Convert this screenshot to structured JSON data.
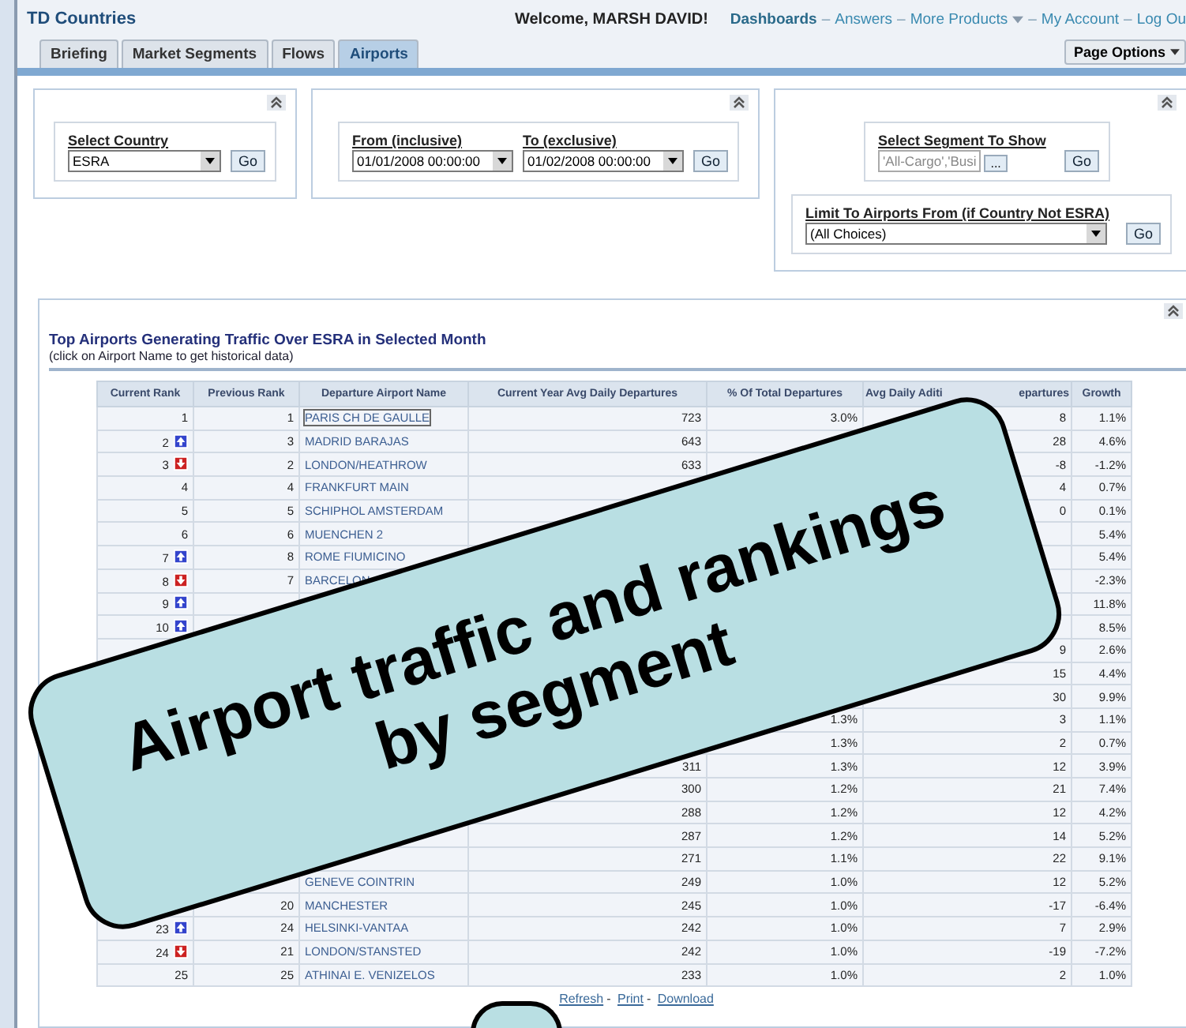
{
  "header": {
    "title": "TD Countries",
    "welcome": "Welcome, MARSH DAVID!",
    "separator": "–",
    "links": [
      {
        "label": "Dashboards",
        "kind": "current"
      },
      {
        "label": "Answers",
        "kind": "link"
      },
      {
        "label": "More Products",
        "kind": "menu"
      },
      {
        "label": "My Account",
        "kind": "link"
      },
      {
        "label": "Log Ou",
        "kind": "link"
      }
    ]
  },
  "tabs": [
    {
      "label": "Briefing",
      "selected": false
    },
    {
      "label": "Market Segments",
      "selected": false
    },
    {
      "label": "Flows",
      "selected": false
    },
    {
      "label": "Airports",
      "selected": true
    }
  ],
  "page_options": "Page Options",
  "prompts": {
    "country": {
      "label": "Select Country",
      "value": "ESRA",
      "go": "Go"
    },
    "dates": {
      "from_label": "From (inclusive)",
      "from_value": "01/01/2008 00:00:00",
      "to_label": "To (exclusive)",
      "to_value": "01/02/2008 00:00:00",
      "go": "Go"
    },
    "segment": {
      "label": "Select Segment To Show",
      "value": "'All-Cargo','Busi",
      "browse": "...",
      "go": "Go"
    },
    "limit": {
      "label": "Limit To Airports From (if Country Not ESRA)",
      "value": "(All Choices)",
      "go": "Go"
    }
  },
  "report": {
    "title": "Top Airports Generating Traffic Over ESRA in Selected Month",
    "subtitle": "(click on Airport Name to get historical data)",
    "columns": [
      {
        "parts": [
          "Current Rank"
        ]
      },
      {
        "parts": [
          "Previous Rank"
        ]
      },
      {
        "parts": [
          "Departure Airport Name"
        ]
      },
      {
        "parts": [
          "Current Year Avg Daily Departures"
        ]
      },
      {
        "parts": [
          "% Of Total Departures"
        ]
      },
      {
        "parts": [
          "Avg Daily Aditi",
          "epartures"
        ]
      },
      {
        "parts": [
          "Growth"
        ]
      }
    ],
    "rows": [
      {
        "kind": "rank_same",
        "cells": [
          "1",
          "1",
          "PARIS CH DE GAULLE",
          "723",
          "3.0%",
          "8",
          "1.1%"
        ]
      },
      {
        "kind": "rank_up",
        "cells": [
          "2",
          "3",
          "MADRID BARAJAS",
          "643",
          null,
          "28",
          "4.6%"
        ]
      },
      {
        "kind": "rank_down",
        "cells": [
          "3",
          "2",
          "LONDON/HEATHROW",
          "633",
          null,
          "-8",
          "-1.2%"
        ]
      },
      {
        "kind": "rank_same",
        "cells": [
          "4",
          "4",
          "FRANKFURT MAIN",
          null,
          null,
          "4",
          "0.7%"
        ]
      },
      {
        "kind": "rank_same",
        "cells": [
          "5",
          "5",
          "SCHIPHOL AMSTERDAM",
          null,
          null,
          "0",
          "0.1%"
        ]
      },
      {
        "kind": "rank_same",
        "cells": [
          "6",
          "6",
          "MUENCHEN 2",
          null,
          null,
          null,
          "5.4%"
        ]
      },
      {
        "kind": "rank_up",
        "cells": [
          "7",
          "8",
          "ROME FIUMICINO",
          null,
          null,
          null,
          "5.4%"
        ]
      },
      {
        "kind": "rank_down",
        "cells": [
          "8",
          "7",
          "BARCELON",
          null,
          null,
          null,
          "-2.3%"
        ]
      },
      {
        "kind": "rank_up",
        "cells": [
          "9",
          null,
          null,
          null,
          null,
          null,
          "11.8%"
        ]
      },
      {
        "kind": "rank_up",
        "cells": [
          "10",
          null,
          null,
          null,
          null,
          null,
          "8.5%"
        ]
      },
      {
        "cells": [
          null,
          null,
          null,
          null,
          null,
          "9",
          "2.6%"
        ]
      },
      {
        "cells": [
          null,
          null,
          null,
          null,
          null,
          "15",
          "4.4%"
        ]
      },
      {
        "cells": [
          null,
          null,
          null,
          null,
          null,
          "30",
          "9.9%"
        ]
      },
      {
        "cells": [
          null,
          null,
          null,
          null,
          "1.3%",
          "3",
          "1.1%"
        ]
      },
      {
        "cells": [
          null,
          null,
          null,
          null,
          "1.3%",
          "2",
          "0.7%"
        ]
      },
      {
        "cells": [
          null,
          null,
          null,
          "311",
          "1.3%",
          "12",
          "3.9%"
        ]
      },
      {
        "cells": [
          null,
          null,
          null,
          "300",
          "1.2%",
          "21",
          "7.4%"
        ]
      },
      {
        "cells": [
          null,
          null,
          null,
          "288",
          "1.2%",
          "12",
          "4.2%"
        ]
      },
      {
        "cells": [
          null,
          null,
          null,
          "287",
          "1.2%",
          "14",
          "5.2%"
        ]
      },
      {
        "cells": [
          null,
          null,
          null,
          "271",
          "1.1%",
          "22",
          "9.1%"
        ]
      },
      {
        "cells": [
          null,
          null,
          "GENEVE COINTRIN",
          "249",
          "1.0%",
          "12",
          "5.2%"
        ]
      },
      {
        "cells": [
          null,
          "20",
          "MANCHESTER",
          "245",
          "1.0%",
          "-17",
          "-6.4%"
        ]
      },
      {
        "kind": "rank_up",
        "cells": [
          "23",
          "24",
          "HELSINKI-VANTAA",
          "242",
          "1.0%",
          "7",
          "2.9%"
        ]
      },
      {
        "kind": "rank_down",
        "cells": [
          "24",
          "21",
          "LONDON/STANSTED",
          "242",
          "1.0%",
          "-19",
          "-7.2%"
        ]
      },
      {
        "kind": "rank_same",
        "cells": [
          "25",
          "25",
          "ATHINAI E. VENIZELOS",
          "233",
          "1.0%",
          "2",
          "1.0%"
        ]
      }
    ],
    "footer_separator": "-",
    "footer_links": [
      "Refresh",
      "Print",
      "Download"
    ]
  },
  "callout": {
    "text": "Airport traffic and rankings by segment"
  }
}
